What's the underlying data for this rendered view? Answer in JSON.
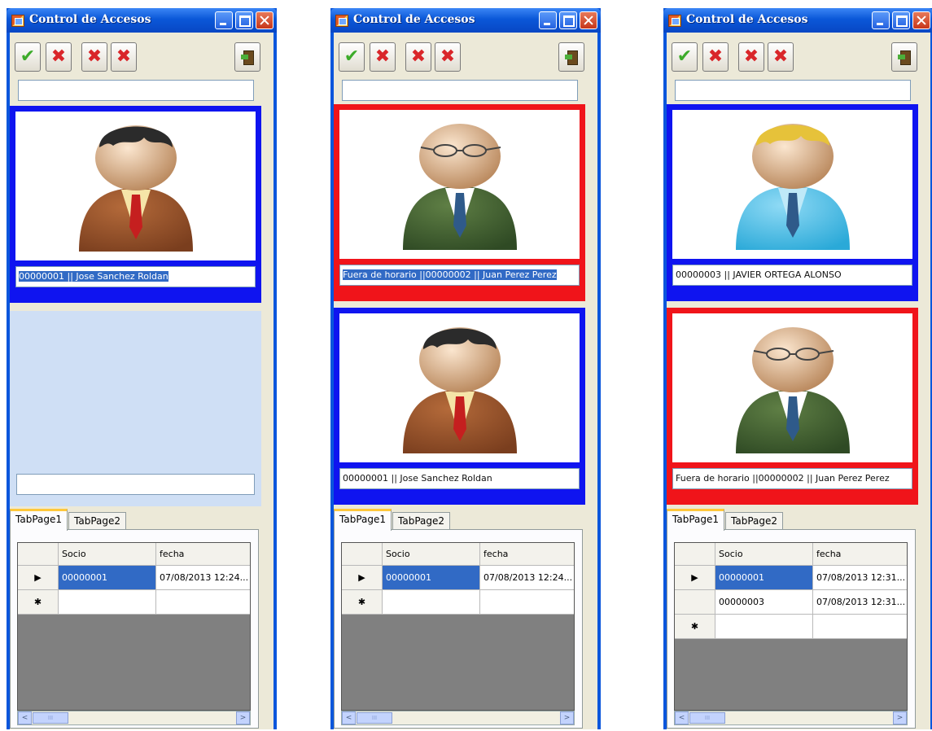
{
  "windows": [
    {
      "title": "Control de Accesos",
      "cards": [
        {
          "border_color": "#0f14f0",
          "avatar": "brown-suit-dark-hair",
          "caption": "00000001 || Jose Sanchez Roldan",
          "caption_selected": true
        }
      ],
      "empty_caption": "",
      "tabs": [
        "TabPage1",
        "TabPage2"
      ],
      "grid": {
        "columns": [
          "Socio",
          "fecha"
        ],
        "rows": [
          {
            "marker": "▶",
            "socio": "00000001",
            "fecha": "07/08/2013 12:24...",
            "selected": true
          },
          {
            "marker": "✱",
            "socio": "",
            "fecha": "",
            "selected": false
          }
        ]
      }
    },
    {
      "title": "Control de Accesos",
      "cards": [
        {
          "border_color": "#f0141a",
          "avatar": "green-suit-glasses",
          "caption": "Fuera de horario ||00000002 || Juan Perez Perez",
          "caption_selected": true
        },
        {
          "border_color": "#0f14f0",
          "avatar": "brown-suit-dark-hair",
          "caption": "00000001 || Jose Sanchez Roldan",
          "caption_selected": false
        }
      ],
      "tabs": [
        "TabPage1",
        "TabPage2"
      ],
      "grid": {
        "columns": [
          "Socio",
          "fecha"
        ],
        "rows": [
          {
            "marker": "▶",
            "socio": "00000001",
            "fecha": "07/08/2013 12:24...",
            "selected": true
          },
          {
            "marker": "✱",
            "socio": "",
            "fecha": "",
            "selected": false
          }
        ]
      }
    },
    {
      "title": "Control de Accesos",
      "cards": [
        {
          "border_color": "#0f14f0",
          "avatar": "blue-shirt-blond",
          "caption": "00000003 || JAVIER ORTEGA ALONSO",
          "caption_selected": false
        },
        {
          "border_color": "#f0141a",
          "avatar": "green-suit-glasses",
          "caption": "Fuera de horario ||00000002 || Juan Perez Perez",
          "caption_selected": false
        }
      ],
      "tabs": [
        "TabPage1",
        "TabPage2"
      ],
      "grid": {
        "columns": [
          "Socio",
          "fecha"
        ],
        "rows": [
          {
            "marker": "▶",
            "socio": "00000001",
            "fecha": "07/08/2013 12:31...",
            "selected": true
          },
          {
            "marker": "",
            "socio": "00000003",
            "fecha": "07/08/2013 12:31...",
            "selected": false
          },
          {
            "marker": "✱",
            "socio": "",
            "fecha": "",
            "selected": false
          }
        ]
      }
    }
  ],
  "toolbar": {
    "buttons": [
      {
        "icon": "check-icon",
        "glyph": "✔"
      },
      {
        "icon": "x-icon",
        "glyph": "✖"
      },
      {
        "icon": "x-icon",
        "glyph": "✖"
      },
      {
        "icon": "x-icon",
        "glyph": "✖"
      }
    ],
    "exit_icon": "exit-door-icon"
  },
  "scrollbar": {
    "left": "<",
    "right": ">",
    "thumb": "III"
  }
}
